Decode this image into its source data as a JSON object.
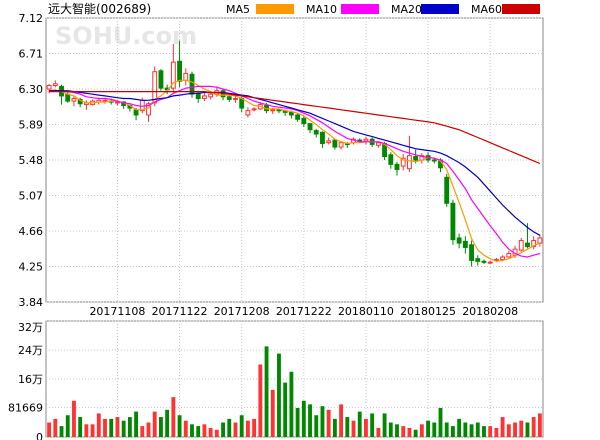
{
  "title": "远大智能(002689)",
  "watermark": "SOHU.com",
  "colors": {
    "up": "#ff3333",
    "down": "#008800",
    "grid": "#c8c8c8",
    "ma5": "#ff9900",
    "ma10": "#ff00ff",
    "ma20": "#0000cc",
    "ma60": "#cc0000"
  },
  "chart_data": [
    {
      "type": "candlestick",
      "title": "远大智能(002689)",
      "ylim": [
        3.84,
        7.12
      ],
      "yticks": [
        "7.12",
        "6.71",
        "6.30",
        "5.89",
        "5.48",
        "5.07",
        "4.66",
        "4.25",
        "3.84"
      ],
      "xticks": [
        {
          "label": "20171108",
          "index": 11
        },
        {
          "label": "20171122",
          "index": 21
        },
        {
          "label": "20171208",
          "index": 31
        },
        {
          "label": "20171222",
          "index": 41
        },
        {
          "label": "20180110",
          "index": 51
        },
        {
          "label": "20180125",
          "index": 61
        },
        {
          "label": "20180208",
          "index": 71
        }
      ],
      "series": [
        {
          "name": "MA5",
          "color": "#ff9900"
        },
        {
          "name": "MA10",
          "color": "#ff00ff"
        },
        {
          "name": "MA20",
          "color": "#0000cc"
        },
        {
          "name": "MA60",
          "color": "#cc0000"
        }
      ],
      "candles": [
        [
          6.3,
          6.34,
          6.25,
          6.36
        ],
        [
          6.34,
          6.36,
          6.32,
          6.4
        ],
        [
          6.33,
          6.22,
          6.12,
          6.35
        ],
        [
          6.24,
          6.16,
          6.14,
          6.27
        ],
        [
          6.16,
          6.19,
          6.1,
          6.22
        ],
        [
          6.18,
          6.13,
          6.09,
          6.2
        ],
        [
          6.12,
          6.14,
          6.06,
          6.17
        ],
        [
          6.12,
          6.16,
          6.11,
          6.18
        ],
        [
          6.15,
          6.17,
          6.12,
          6.2
        ],
        [
          6.16,
          6.17,
          6.13,
          6.2
        ],
        [
          6.16,
          6.15,
          6.12,
          6.19
        ],
        [
          6.14,
          6.15,
          6.11,
          6.17
        ],
        [
          6.15,
          6.11,
          6.07,
          6.16
        ],
        [
          6.11,
          6.08,
          6.04,
          6.12
        ],
        [
          6.06,
          6.0,
          5.94,
          6.08
        ],
        [
          6.05,
          6.17,
          6.02,
          6.2
        ],
        [
          6.0,
          6.13,
          5.92,
          6.15
        ],
        [
          6.14,
          6.5,
          6.1,
          6.56
        ],
        [
          6.51,
          6.31,
          6.28,
          6.53
        ],
        [
          6.31,
          6.29,
          6.24,
          6.35
        ],
        [
          6.31,
          6.61,
          6.26,
          6.82
        ],
        [
          6.62,
          6.39,
          6.32,
          6.86
        ],
        [
          6.4,
          6.48,
          6.34,
          6.54
        ],
        [
          6.47,
          6.24,
          6.2,
          6.5
        ],
        [
          6.25,
          6.19,
          6.14,
          6.28
        ],
        [
          6.19,
          6.22,
          6.16,
          6.25
        ],
        [
          6.21,
          6.24,
          6.18,
          6.27
        ],
        [
          6.24,
          6.28,
          6.21,
          6.33
        ],
        [
          6.28,
          6.21,
          6.17,
          6.3
        ],
        [
          6.21,
          6.18,
          6.15,
          6.23
        ],
        [
          6.18,
          6.19,
          6.14,
          6.22
        ],
        [
          6.19,
          6.08,
          6.03,
          6.21
        ],
        [
          6.0,
          6.05,
          5.97,
          6.09
        ],
        [
          6.06,
          6.07,
          6.04,
          6.09
        ],
        [
          6.07,
          6.12,
          6.06,
          6.15
        ],
        [
          6.11,
          6.05,
          6.02,
          6.14
        ],
        [
          6.05,
          6.06,
          6.01,
          6.08
        ],
        [
          6.06,
          6.05,
          6.02,
          6.07
        ],
        [
          6.05,
          6.03,
          5.99,
          6.06
        ],
        [
          6.03,
          6.0,
          5.96,
          6.05
        ],
        [
          6.0,
          5.95,
          5.92,
          6.02
        ],
        [
          5.96,
          5.9,
          5.86,
          5.99
        ],
        [
          5.9,
          5.83,
          5.79,
          5.91
        ],
        [
          5.82,
          5.78,
          5.74,
          5.84
        ],
        [
          5.8,
          5.67,
          5.62,
          5.81
        ],
        [
          5.68,
          5.7,
          5.66,
          5.74
        ],
        [
          5.71,
          5.63,
          5.6,
          5.72
        ],
        [
          5.63,
          5.68,
          5.6,
          5.7
        ],
        [
          5.67,
          5.66,
          5.62,
          5.69
        ],
        [
          5.68,
          5.72,
          5.66,
          5.74
        ],
        [
          5.71,
          5.7,
          5.68,
          5.73
        ],
        [
          5.7,
          5.72,
          5.66,
          5.75
        ],
        [
          5.72,
          5.66,
          5.63,
          5.74
        ],
        [
          5.65,
          5.68,
          5.62,
          5.7
        ],
        [
          5.67,
          5.52,
          5.48,
          5.69
        ],
        [
          5.54,
          5.43,
          5.38,
          5.57
        ],
        [
          5.43,
          5.37,
          5.3,
          5.46
        ],
        [
          5.41,
          5.5,
          5.36,
          5.55
        ],
        [
          5.38,
          5.53,
          5.34,
          5.76
        ],
        [
          5.52,
          5.48,
          5.44,
          5.6
        ],
        [
          5.48,
          5.53,
          5.44,
          5.56
        ],
        [
          5.53,
          5.48,
          5.45,
          5.57
        ],
        [
          5.48,
          5.47,
          5.44,
          5.51
        ],
        [
          5.48,
          5.39,
          5.34,
          5.5
        ],
        [
          5.28,
          4.98,
          4.94,
          5.32
        ],
        [
          4.98,
          4.56,
          4.5,
          5.02
        ],
        [
          4.58,
          4.52,
          4.46,
          4.63
        ],
        [
          4.54,
          4.47,
          4.4,
          4.6
        ],
        [
          4.5,
          4.32,
          4.25,
          4.55
        ],
        [
          4.34,
          4.31,
          4.26,
          4.38
        ],
        [
          4.31,
          4.3,
          4.28,
          4.33
        ],
        [
          4.3,
          4.3,
          4.28,
          4.32
        ],
        [
          4.32,
          4.33,
          4.3,
          4.35
        ],
        [
          4.33,
          4.36,
          4.31,
          4.38
        ],
        [
          4.36,
          4.4,
          4.35,
          4.43
        ],
        [
          4.38,
          4.45,
          4.35,
          4.49
        ],
        [
          4.44,
          4.55,
          4.42,
          4.58
        ],
        [
          4.52,
          4.48,
          4.46,
          4.75
        ],
        [
          4.48,
          4.55,
          4.45,
          4.6
        ],
        [
          4.52,
          4.58,
          4.48,
          4.62
        ]
      ],
      "ma5": [
        6.28,
        6.29,
        6.27,
        6.24,
        6.22,
        6.17,
        6.14,
        6.14,
        6.15,
        6.15,
        6.16,
        6.16,
        6.14,
        6.11,
        6.06,
        6.06,
        6.08,
        6.18,
        6.22,
        6.28,
        6.37,
        6.4,
        6.4,
        6.38,
        6.34,
        6.3,
        6.27,
        6.23,
        6.23,
        6.23,
        6.22,
        6.19,
        6.15,
        6.11,
        6.1,
        6.07,
        6.07,
        6.07,
        6.05,
        6.04,
        6.02,
        5.99,
        5.94,
        5.89,
        5.83,
        5.78,
        5.72,
        5.69,
        5.67,
        5.68,
        5.68,
        5.69,
        5.69,
        5.69,
        5.66,
        5.6,
        5.53,
        5.48,
        5.47,
        5.46,
        5.48,
        5.51,
        5.5,
        5.47,
        5.37,
        5.18,
        4.99,
        4.79,
        4.57,
        4.44,
        4.38,
        4.34,
        4.31,
        4.32,
        4.34,
        4.37,
        4.41,
        4.45,
        4.49,
        4.52
      ],
      "ma10": [
        6.27,
        6.28,
        6.28,
        6.27,
        6.26,
        6.24,
        6.21,
        6.2,
        6.19,
        6.19,
        6.18,
        6.16,
        6.14,
        6.13,
        6.11,
        6.1,
        6.11,
        6.15,
        6.18,
        6.2,
        6.25,
        6.28,
        6.31,
        6.32,
        6.33,
        6.33,
        6.33,
        6.32,
        6.3,
        6.28,
        6.25,
        6.22,
        6.19,
        6.16,
        6.14,
        6.12,
        6.1,
        6.09,
        6.08,
        6.07,
        6.05,
        6.02,
        5.99,
        5.95,
        5.91,
        5.86,
        5.81,
        5.77,
        5.73,
        5.71,
        5.69,
        5.69,
        5.69,
        5.69,
        5.67,
        5.64,
        5.61,
        5.58,
        5.56,
        5.54,
        5.52,
        5.51,
        5.5,
        5.48,
        5.44,
        5.35,
        5.25,
        5.15,
        5.02,
        4.92,
        4.82,
        4.72,
        4.63,
        4.53,
        4.45,
        4.4,
        4.37,
        4.36,
        4.38,
        4.4
      ],
      "ma20": [
        6.28,
        6.28,
        6.28,
        6.28,
        6.27,
        6.26,
        6.25,
        6.24,
        6.23,
        6.22,
        6.21,
        6.2,
        6.19,
        6.19,
        6.18,
        6.17,
        6.17,
        6.18,
        6.19,
        6.2,
        6.22,
        6.23,
        6.24,
        6.25,
        6.25,
        6.26,
        6.26,
        6.26,
        6.26,
        6.25,
        6.24,
        6.23,
        6.22,
        6.2,
        6.18,
        6.16,
        6.14,
        6.12,
        6.1,
        6.08,
        6.06,
        6.04,
        6.02,
        5.99,
        5.96,
        5.93,
        5.9,
        5.87,
        5.84,
        5.81,
        5.79,
        5.77,
        5.75,
        5.73,
        5.71,
        5.69,
        5.67,
        5.65,
        5.63,
        5.61,
        5.6,
        5.59,
        5.58,
        5.56,
        5.53,
        5.49,
        5.45,
        5.4,
        5.34,
        5.28,
        5.2,
        5.12,
        5.04,
        4.96,
        4.89,
        4.82,
        4.76,
        4.7,
        4.65,
        4.61
      ],
      "ma60": [
        6.27,
        6.27,
        6.27,
        6.27,
        6.27,
        6.27,
        6.27,
        6.27,
        6.27,
        6.27,
        6.27,
        6.27,
        6.27,
        6.27,
        6.27,
        6.27,
        6.27,
        6.27,
        6.27,
        6.27,
        6.27,
        6.27,
        6.27,
        6.27,
        6.27,
        6.27,
        6.26,
        6.26,
        6.25,
        6.24,
        6.23,
        6.22,
        6.21,
        6.2,
        6.19,
        6.18,
        6.17,
        6.16,
        6.15,
        6.14,
        6.13,
        6.12,
        6.11,
        6.1,
        6.09,
        6.08,
        6.07,
        6.06,
        6.05,
        6.04,
        6.03,
        6.02,
        6.01,
        6.0,
        5.99,
        5.98,
        5.97,
        5.96,
        5.95,
        5.94,
        5.93,
        5.92,
        5.91,
        5.89,
        5.87,
        5.85,
        5.83,
        5.8,
        5.77,
        5.74,
        5.71,
        5.68,
        5.65,
        5.62,
        5.59,
        5.56,
        5.53,
        5.5,
        5.47,
        5.44
      ]
    },
    {
      "type": "bar",
      "ylim": [
        0,
        320000
      ],
      "yticks": [
        "32万",
        "24万",
        "16万",
        "81669",
        "0"
      ],
      "ytick_values": [
        320000,
        240000,
        160000,
        81669,
        0
      ],
      "values": [
        40000,
        50000,
        30000,
        60000,
        100000,
        55000,
        35000,
        35000,
        65000,
        50000,
        50000,
        55000,
        45000,
        55000,
        70000,
        30000,
        40000,
        70000,
        55000,
        75000,
        110000,
        60000,
        45000,
        35000,
        30000,
        35000,
        25000,
        20000,
        40000,
        50000,
        40000,
        60000,
        45000,
        50000,
        200000,
        250000,
        130000,
        230000,
        150000,
        180000,
        80000,
        100000,
        90000,
        60000,
        85000,
        75000,
        50000,
        90000,
        55000,
        45000,
        70000,
        50000,
        65000,
        25000,
        65000,
        40000,
        35000,
        30000,
        25000,
        20000,
        35000,
        45000,
        40000,
        80000,
        40000,
        30000,
        50000,
        40000,
        35000,
        40000,
        30000,
        30000,
        25000,
        55000,
        35000,
        40000,
        45000,
        40000,
        55000,
        65000
      ]
    }
  ]
}
